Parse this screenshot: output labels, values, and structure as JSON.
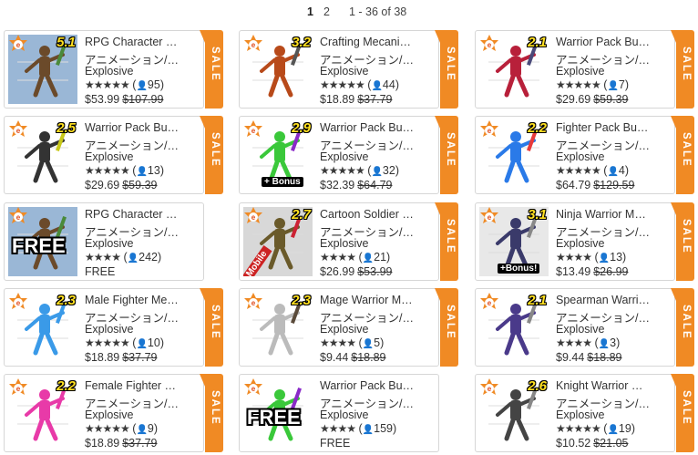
{
  "pagination": {
    "page1": "1",
    "page2": "2",
    "range": "1 - 36 of 38"
  },
  "sale_label": "SALE",
  "category": "アニメーション/…",
  "publisher": "Explosive",
  "cards": [
    {
      "title": "RPG Character …",
      "version": "5.1",
      "stars": "★★★★★",
      "count": "95",
      "price": "$53.99",
      "old": "$107.99",
      "sale": true
    },
    {
      "title": "Crafting Mecani…",
      "version": "3.2",
      "stars": "★★★★★",
      "count": "44",
      "price": "$18.89",
      "old": "$37.79",
      "sale": true
    },
    {
      "title": "Warrior Pack Bu…",
      "version": "2.1",
      "stars": "★★★★★",
      "count": "7",
      "price": "$29.69",
      "old": "$59.39",
      "sale": true
    },
    {
      "title": "Warrior Pack Bu…",
      "version": "2.5",
      "stars": "★★★★★",
      "count": "13",
      "price": "$29.69",
      "old": "$59.39",
      "sale": true
    },
    {
      "title": "Warrior Pack Bu…",
      "version": "2.9",
      "stars": "★★★★★",
      "count": "32",
      "price": "$32.39",
      "old": "$64.79",
      "sale": true,
      "tag": "+ Bonus"
    },
    {
      "title": "Fighter Pack Bu…",
      "version": "2.2",
      "stars": "★★★★★",
      "count": "4",
      "price": "$64.79",
      "old": "$129.59",
      "sale": true
    },
    {
      "title": "RPG Character …",
      "version": "",
      "stars": "★★★★",
      "count": "242",
      "price": "FREE",
      "old": "",
      "sale": false,
      "free": "FREE"
    },
    {
      "title": "Cartoon Soldier …",
      "version": "2.7",
      "stars": "★★★★",
      "count": "21",
      "price": "$26.99",
      "old": "$53.99",
      "sale": true,
      "mobile": "Mobile"
    },
    {
      "title": "Ninja Warrior M…",
      "version": "3.1",
      "stars": "★★★★",
      "count": "13",
      "price": "$13.49",
      "old": "$26.99",
      "sale": true,
      "tag": "+Bonus!"
    },
    {
      "title": "Male Fighter Me…",
      "version": "2.3",
      "stars": "★★★★★",
      "count": "10",
      "price": "$18.89",
      "old": "$37.79",
      "sale": true
    },
    {
      "title": "Mage Warrior M…",
      "version": "2.3",
      "stars": "★★★★",
      "count": "5",
      "price": "$9.44",
      "old": "$18.89",
      "sale": true
    },
    {
      "title": "Spearman Warri…",
      "version": "2.1",
      "stars": "★★★★",
      "count": "3",
      "price": "$9.44",
      "old": "$18.89",
      "sale": true
    },
    {
      "title": "Female Fighter …",
      "version": "2.2",
      "stars": "★★★★★",
      "count": "9",
      "price": "$18.89",
      "old": "$37.79",
      "sale": true
    },
    {
      "title": "Warrior Pack Bu…",
      "version": "",
      "stars": "★★★★",
      "count": "159",
      "price": "FREE",
      "old": "",
      "sale": false,
      "free": "FREE"
    },
    {
      "title": "Knight Warrior …",
      "version": "2.6",
      "stars": "★★★★★",
      "count": "19",
      "price": "$10.52",
      "old": "$21.05",
      "sale": true
    }
  ],
  "colors": {
    "sale": "#f08a24",
    "version": "#ffe020",
    "text": "#333333"
  }
}
